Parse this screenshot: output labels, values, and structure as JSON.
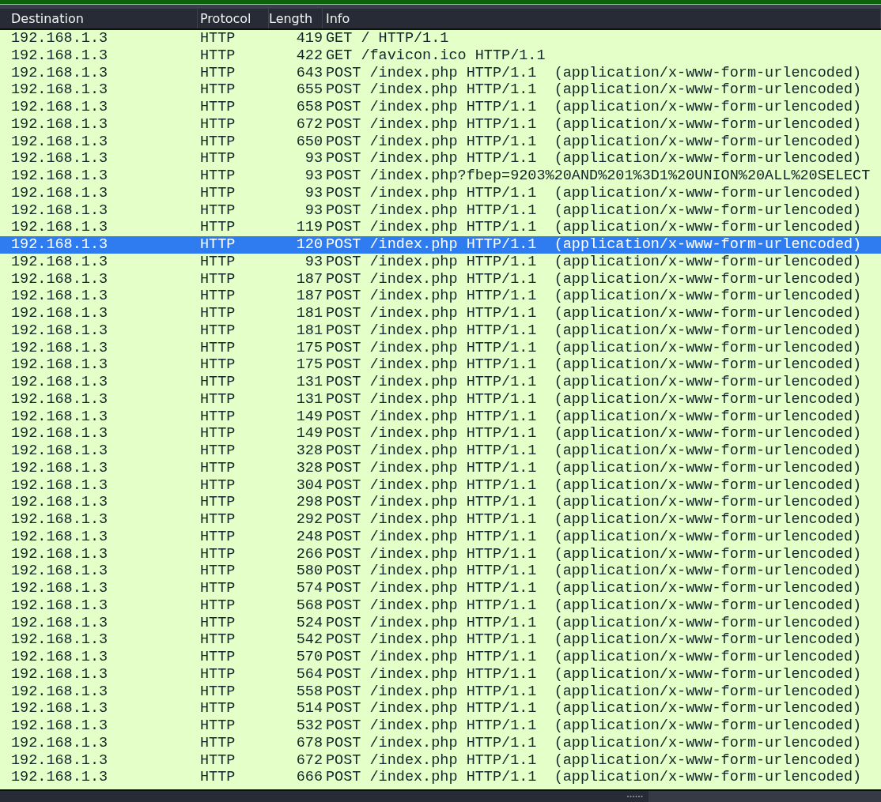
{
  "table": {
    "columns": [
      "Destination",
      "Protocol",
      "Length",
      "Info"
    ],
    "rows": [
      {
        "destination": "192.168.1.3",
        "protocol": "HTTP",
        "length": "419",
        "info": "GET / HTTP/1.1",
        "selected": false
      },
      {
        "destination": "192.168.1.3",
        "protocol": "HTTP",
        "length": "422",
        "info": "GET /favicon.ico HTTP/1.1",
        "selected": false
      },
      {
        "destination": "192.168.1.3",
        "protocol": "HTTP",
        "length": "643",
        "info": "POST /index.php HTTP/1.1  (application/x-www-form-urlencoded)",
        "selected": false
      },
      {
        "destination": "192.168.1.3",
        "protocol": "HTTP",
        "length": "655",
        "info": "POST /index.php HTTP/1.1  (application/x-www-form-urlencoded)",
        "selected": false
      },
      {
        "destination": "192.168.1.3",
        "protocol": "HTTP",
        "length": "658",
        "info": "POST /index.php HTTP/1.1  (application/x-www-form-urlencoded)",
        "selected": false
      },
      {
        "destination": "192.168.1.3",
        "protocol": "HTTP",
        "length": "672",
        "info": "POST /index.php HTTP/1.1  (application/x-www-form-urlencoded)",
        "selected": false
      },
      {
        "destination": "192.168.1.3",
        "protocol": "HTTP",
        "length": "650",
        "info": "POST /index.php HTTP/1.1  (application/x-www-form-urlencoded)",
        "selected": false
      },
      {
        "destination": "192.168.1.3",
        "protocol": "HTTP",
        "length": "93",
        "info": "POST /index.php HTTP/1.1  (application/x-www-form-urlencoded)",
        "selected": false
      },
      {
        "destination": "192.168.1.3",
        "protocol": "HTTP",
        "length": "93",
        "info": "POST /index.php?fbep=9203%20AND%201%3D1%20UNION%20ALL%20SELECT",
        "selected": false
      },
      {
        "destination": "192.168.1.3",
        "protocol": "HTTP",
        "length": "93",
        "info": "POST /index.php HTTP/1.1  (application/x-www-form-urlencoded)",
        "selected": false
      },
      {
        "destination": "192.168.1.3",
        "protocol": "HTTP",
        "length": "93",
        "info": "POST /index.php HTTP/1.1  (application/x-www-form-urlencoded)",
        "selected": false
      },
      {
        "destination": "192.168.1.3",
        "protocol": "HTTP",
        "length": "119",
        "info": "POST /index.php HTTP/1.1  (application/x-www-form-urlencoded)",
        "selected": false
      },
      {
        "destination": "192.168.1.3",
        "protocol": "HTTP",
        "length": "120",
        "info": "POST /index.php HTTP/1.1  (application/x-www-form-urlencoded)",
        "selected": true
      },
      {
        "destination": "192.168.1.3",
        "protocol": "HTTP",
        "length": "93",
        "info": "POST /index.php HTTP/1.1  (application/x-www-form-urlencoded)",
        "selected": false
      },
      {
        "destination": "192.168.1.3",
        "protocol": "HTTP",
        "length": "187",
        "info": "POST /index.php HTTP/1.1  (application/x-www-form-urlencoded)",
        "selected": false
      },
      {
        "destination": "192.168.1.3",
        "protocol": "HTTP",
        "length": "187",
        "info": "POST /index.php HTTP/1.1  (application/x-www-form-urlencoded)",
        "selected": false
      },
      {
        "destination": "192.168.1.3",
        "protocol": "HTTP",
        "length": "181",
        "info": "POST /index.php HTTP/1.1  (application/x-www-form-urlencoded)",
        "selected": false
      },
      {
        "destination": "192.168.1.3",
        "protocol": "HTTP",
        "length": "181",
        "info": "POST /index.php HTTP/1.1  (application/x-www-form-urlencoded)",
        "selected": false
      },
      {
        "destination": "192.168.1.3",
        "protocol": "HTTP",
        "length": "175",
        "info": "POST /index.php HTTP/1.1  (application/x-www-form-urlencoded)",
        "selected": false
      },
      {
        "destination": "192.168.1.3",
        "protocol": "HTTP",
        "length": "175",
        "info": "POST /index.php HTTP/1.1  (application/x-www-form-urlencoded)",
        "selected": false
      },
      {
        "destination": "192.168.1.3",
        "protocol": "HTTP",
        "length": "131",
        "info": "POST /index.php HTTP/1.1  (application/x-www-form-urlencoded)",
        "selected": false
      },
      {
        "destination": "192.168.1.3",
        "protocol": "HTTP",
        "length": "131",
        "info": "POST /index.php HTTP/1.1  (application/x-www-form-urlencoded)",
        "selected": false
      },
      {
        "destination": "192.168.1.3",
        "protocol": "HTTP",
        "length": "149",
        "info": "POST /index.php HTTP/1.1  (application/x-www-form-urlencoded)",
        "selected": false
      },
      {
        "destination": "192.168.1.3",
        "protocol": "HTTP",
        "length": "149",
        "info": "POST /index.php HTTP/1.1  (application/x-www-form-urlencoded)",
        "selected": false
      },
      {
        "destination": "192.168.1.3",
        "protocol": "HTTP",
        "length": "328",
        "info": "POST /index.php HTTP/1.1  (application/x-www-form-urlencoded)",
        "selected": false
      },
      {
        "destination": "192.168.1.3",
        "protocol": "HTTP",
        "length": "328",
        "info": "POST /index.php HTTP/1.1  (application/x-www-form-urlencoded)",
        "selected": false
      },
      {
        "destination": "192.168.1.3",
        "protocol": "HTTP",
        "length": "304",
        "info": "POST /index.php HTTP/1.1  (application/x-www-form-urlencoded)",
        "selected": false
      },
      {
        "destination": "192.168.1.3",
        "protocol": "HTTP",
        "length": "298",
        "info": "POST /index.php HTTP/1.1  (application/x-www-form-urlencoded)",
        "selected": false
      },
      {
        "destination": "192.168.1.3",
        "protocol": "HTTP",
        "length": "292",
        "info": "POST /index.php HTTP/1.1  (application/x-www-form-urlencoded)",
        "selected": false
      },
      {
        "destination": "192.168.1.3",
        "protocol": "HTTP",
        "length": "248",
        "info": "POST /index.php HTTP/1.1  (application/x-www-form-urlencoded)",
        "selected": false
      },
      {
        "destination": "192.168.1.3",
        "protocol": "HTTP",
        "length": "266",
        "info": "POST /index.php HTTP/1.1  (application/x-www-form-urlencoded)",
        "selected": false
      },
      {
        "destination": "192.168.1.3",
        "protocol": "HTTP",
        "length": "580",
        "info": "POST /index.php HTTP/1.1  (application/x-www-form-urlencoded)",
        "selected": false
      },
      {
        "destination": "192.168.1.3",
        "protocol": "HTTP",
        "length": "574",
        "info": "POST /index.php HTTP/1.1  (application/x-www-form-urlencoded)",
        "selected": false
      },
      {
        "destination": "192.168.1.3",
        "protocol": "HTTP",
        "length": "568",
        "info": "POST /index.php HTTP/1.1  (application/x-www-form-urlencoded)",
        "selected": false
      },
      {
        "destination": "192.168.1.3",
        "protocol": "HTTP",
        "length": "524",
        "info": "POST /index.php HTTP/1.1  (application/x-www-form-urlencoded)",
        "selected": false
      },
      {
        "destination": "192.168.1.3",
        "protocol": "HTTP",
        "length": "542",
        "info": "POST /index.php HTTP/1.1  (application/x-www-form-urlencoded)",
        "selected": false
      },
      {
        "destination": "192.168.1.3",
        "protocol": "HTTP",
        "length": "570",
        "info": "POST /index.php HTTP/1.1  (application/x-www-form-urlencoded)",
        "selected": false
      },
      {
        "destination": "192.168.1.3",
        "protocol": "HTTP",
        "length": "564",
        "info": "POST /index.php HTTP/1.1  (application/x-www-form-urlencoded)",
        "selected": false
      },
      {
        "destination": "192.168.1.3",
        "protocol": "HTTP",
        "length": "558",
        "info": "POST /index.php HTTP/1.1  (application/x-www-form-urlencoded)",
        "selected": false
      },
      {
        "destination": "192.168.1.3",
        "protocol": "HTTP",
        "length": "514",
        "info": "POST /index.php HTTP/1.1  (application/x-www-form-urlencoded)",
        "selected": false
      },
      {
        "destination": "192.168.1.3",
        "protocol": "HTTP",
        "length": "532",
        "info": "POST /index.php HTTP/1.1  (application/x-www-form-urlencoded)",
        "selected": false
      },
      {
        "destination": "192.168.1.3",
        "protocol": "HTTP",
        "length": "678",
        "info": "POST /index.php HTTP/1.1  (application/x-www-form-urlencoded)",
        "selected": false
      },
      {
        "destination": "192.168.1.3",
        "protocol": "HTTP",
        "length": "672",
        "info": "POST /index.php HTTP/1.1  (application/x-www-form-urlencoded)",
        "selected": false
      },
      {
        "destination": "192.168.1.3",
        "protocol": "HTTP",
        "length": "666",
        "info": "POST /index.php HTTP/1.1  (application/x-www-form-urlencoded)",
        "selected": false
      }
    ]
  }
}
